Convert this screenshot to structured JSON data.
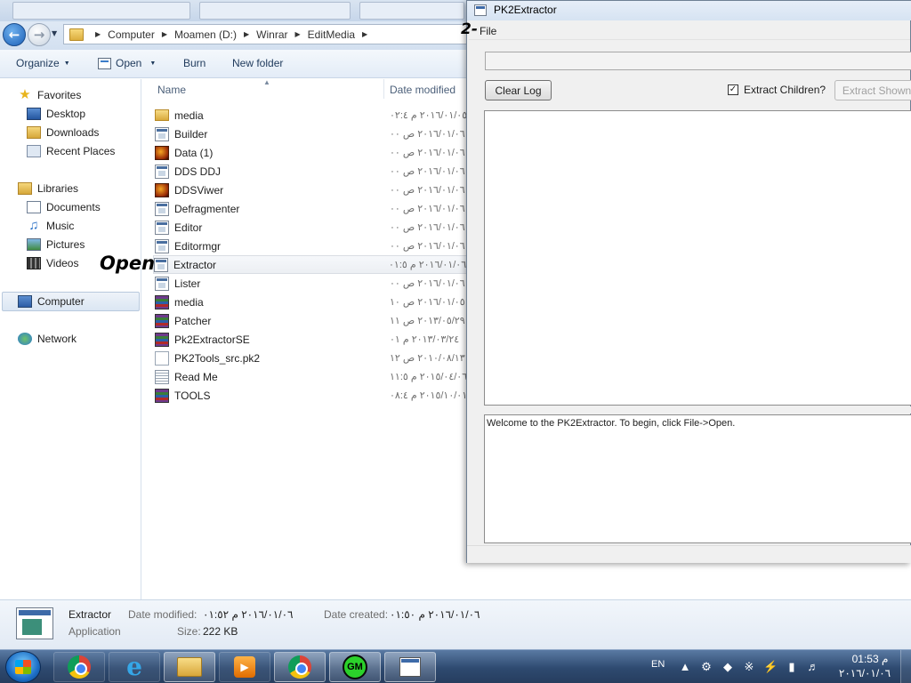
{
  "explorer": {
    "address": {
      "crumbs": [
        "Computer",
        "Moamen (D:)",
        "Winrar",
        "EditMedia"
      ]
    },
    "toolbar": {
      "organize_label": "Organize",
      "open_label": "Open",
      "burn_label": "Burn",
      "new_folder_label": "New folder"
    },
    "nav_pane": {
      "favorites_label": "Favorites",
      "desktop_label": "Desktop",
      "downloads_label": "Downloads",
      "recent_places_label": "Recent Places",
      "libraries_label": "Libraries",
      "documents_label": "Documents",
      "music_label": "Music",
      "pictures_label": "Pictures",
      "videos_label": "Videos",
      "computer_label": "Computer",
      "network_label": "Network"
    },
    "columns": {
      "name": "Name",
      "date_modified": "Date modified"
    },
    "files": [
      {
        "name": "media",
        "date": "٢٠١٦/٠١/٠٥ م ٠٢:٤",
        "icon": "folder-icon"
      },
      {
        "name": "Builder",
        "date": "٢٠١٦/٠١/٠٦ ص ٠٠",
        "icon": "app-icon"
      },
      {
        "name": "Data (1)",
        "date": "٢٠١٦/٠١/٠٦ ص ٠٠",
        "icon": "dragon-icon"
      },
      {
        "name": "DDS DDJ",
        "date": "٢٠١٦/٠١/٠٦ ص ٠٠",
        "icon": "app-icon"
      },
      {
        "name": "DDSViwer",
        "date": "٢٠١٦/٠١/٠٦ ص ٠٠",
        "icon": "dragon-icon"
      },
      {
        "name": "Defragmenter",
        "date": "٢٠١٦/٠١/٠٦ ص ٠٠",
        "icon": "app-icon"
      },
      {
        "name": "Editor",
        "date": "٢٠١٦/٠١/٠٦ ص ٠٠",
        "icon": "app-icon"
      },
      {
        "name": "Editormgr",
        "date": "٢٠١٦/٠١/٠٦ ص ٠٠",
        "icon": "app-icon"
      },
      {
        "name": "Extractor",
        "date": "٢٠١٦/٠١/٠٦ م ٠١:٥",
        "icon": "app-icon"
      },
      {
        "name": "Lister",
        "date": "٢٠١٦/٠١/٠٦ ص ٠٠",
        "icon": "app-icon"
      },
      {
        "name": "media",
        "date": "٢٠١٦/٠١/٠٥ ص ١٠",
        "icon": "winrar-archive-icon"
      },
      {
        "name": "Patcher",
        "date": "٢٠١٣/٠٥/٢٩ ص ١١",
        "icon": "winrar-archive-icon"
      },
      {
        "name": "Pk2ExtractorSE",
        "date": "٢٠١٣/٠٣/٢٤ م ٠١",
        "icon": "winrar-archive-icon"
      },
      {
        "name": "PK2Tools_src.pk2",
        "date": "٢٠١٠/٠٨/١٣ ص ١٢",
        "icon": "file-icon"
      },
      {
        "name": "Read Me",
        "date": "٢٠١٥/٠٤/٠٦ م ١١:٥",
        "icon": "text-file-icon"
      },
      {
        "name": "TOOLS",
        "date": "٢٠١٥/١٠/٠١ م ٠٨:٤",
        "icon": "winrar-archive-icon"
      }
    ],
    "annotation_open": "Open",
    "details": {
      "name": "Extractor",
      "type": "Application",
      "date_modified_label": "Date modified:",
      "date_modified_value": "٢٠١٦/٠١/٠٦ م ٠١:٥٢",
      "size_label": "Size:",
      "size_value": "222 KB",
      "date_created_label": "Date created:",
      "date_created_value": "٢٠١٦/٠١/٠٦ م ٠١:٥٠"
    }
  },
  "pk2extractor": {
    "title": "PK2Extractor",
    "menu_file": "File",
    "annotation_step": "2-",
    "clear_log_label": "Clear Log",
    "extract_children_label": "Extract Children?",
    "extract_children_checked": true,
    "extract_shown_label": "Extract Shown",
    "log_text": "Welcome to the PK2Extractor. To begin, click File->Open."
  },
  "taskbar": {
    "gm_label": "GM",
    "language": "EN",
    "time": "01:53 م",
    "date": "٢٠١٦/٠١/٠٦"
  }
}
